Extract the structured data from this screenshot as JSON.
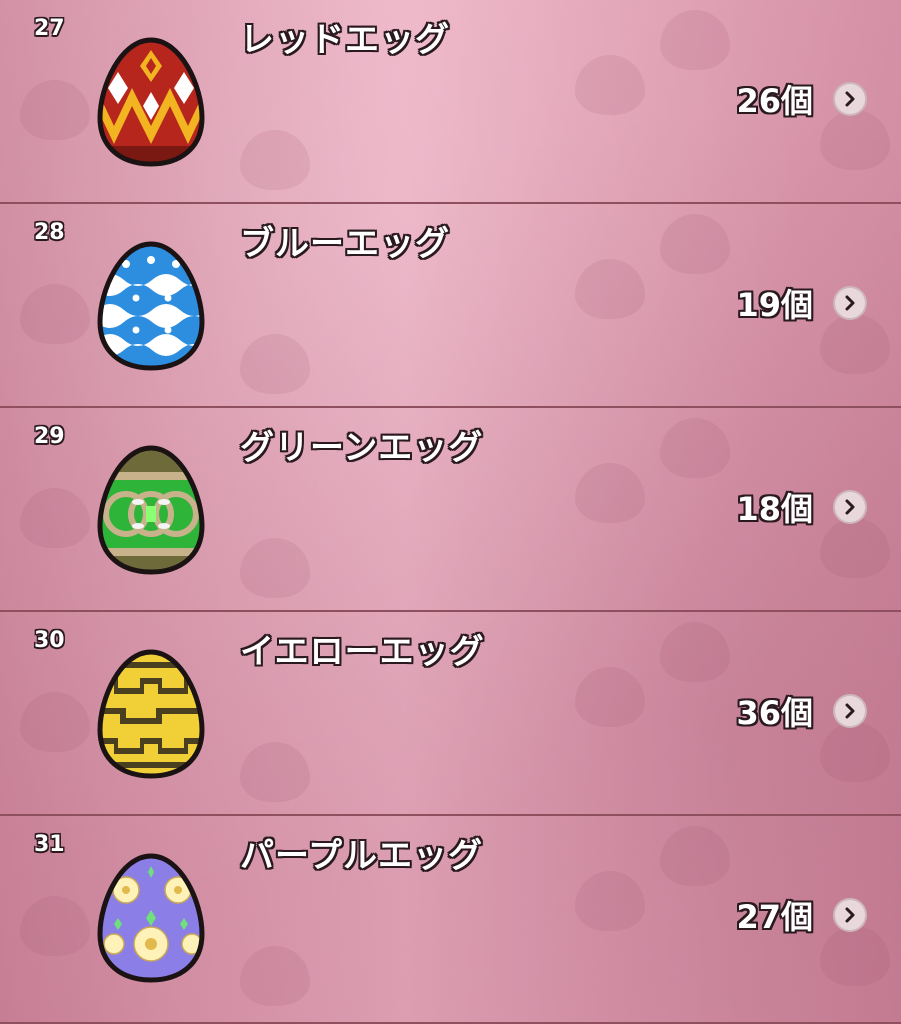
{
  "items": [
    {
      "num": "27",
      "name": "レッドエッグ",
      "count": "26個",
      "icon": "red-egg-icon",
      "base_color": "#b7261d",
      "pattern_color": "#f3b422"
    },
    {
      "num": "28",
      "name": "ブルーエッグ",
      "count": "19個",
      "icon": "blue-egg-icon",
      "base_color": "#2d8ee0",
      "pattern_color": "#ffffff"
    },
    {
      "num": "29",
      "name": "グリーンエッグ",
      "count": "18個",
      "icon": "green-egg-icon",
      "base_color": "#2fb43a",
      "pattern_color": "#c8b28c"
    },
    {
      "num": "30",
      "name": "イエローエッグ",
      "count": "36個",
      "icon": "yellow-egg-icon",
      "base_color": "#f1cf37",
      "pattern_color": "#4a3f1e"
    },
    {
      "num": "31",
      "name": "パープルエッグ",
      "count": "27個",
      "icon": "purple-egg-icon",
      "base_color": "#8b7ee6",
      "pattern_color": "#fff2b8"
    }
  ]
}
